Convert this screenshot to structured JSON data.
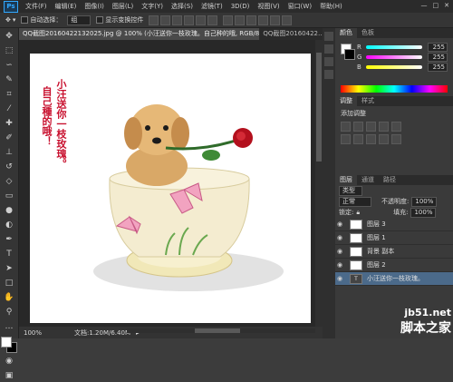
{
  "app": {
    "logo": "Ps"
  },
  "menu": [
    "文件(F)",
    "编辑(E)",
    "图像(I)",
    "图层(L)",
    "文字(Y)",
    "选择(S)",
    "滤镜(T)",
    "3D(D)",
    "视图(V)",
    "窗口(W)",
    "帮助(H)"
  ],
  "window_controls": [
    "—",
    "□",
    "✕"
  ],
  "options": {
    "auto_select_label": "自动选择：",
    "auto_select_value": "组",
    "show_transform_label": "显示变换控件"
  },
  "tabs": {
    "active": "QQ截图20160422132025.jpg @ 100% (小汪送你一枝玫瑰。自己种的哦, RGB/8#) *",
    "inactive": "QQ截图20160422…"
  },
  "canvas_text": {
    "line1": "小汪送你一枝玫瑰。",
    "line2": "自己種的哦！"
  },
  "status": {
    "zoom": "100%",
    "doc": "文档:1.20M/6.40M"
  },
  "color_panel": {
    "tabs": [
      "颜色",
      "色板"
    ],
    "channels": [
      {
        "label": "R",
        "value": "255"
      },
      {
        "label": "G",
        "value": "255"
      },
      {
        "label": "B",
        "value": "255"
      }
    ]
  },
  "adjust_panel": {
    "tabs": [
      "调整",
      "样式"
    ],
    "title": "添加调整"
  },
  "layers_panel": {
    "tabs": [
      "图层",
      "通道",
      "路径"
    ],
    "filter_label": "类型",
    "blend_mode": "正常",
    "opacity_label": "不透明度:",
    "opacity_value": "100%",
    "lock_label": "锁定:",
    "fill_label": "填充:",
    "fill_value": "100%",
    "layers": [
      {
        "name": "图层 3",
        "selected": false,
        "kind": "image"
      },
      {
        "name": "图层 1",
        "selected": false,
        "kind": "image"
      },
      {
        "name": "背景 副本",
        "selected": false,
        "kind": "image"
      },
      {
        "name": "图层 2",
        "selected": false,
        "kind": "image"
      },
      {
        "name": "小汪送你一枝玫瑰。",
        "selected": true,
        "kind": "text"
      }
    ]
  },
  "watermark": {
    "url": "jb51.net",
    "home": "脚本之家"
  },
  "colors": {
    "accent": "#31a8ff",
    "selected_layer": "#4b6a8a",
    "text_red": "#c8102e"
  },
  "icons": [
    "move-tool-icon",
    "marquee-tool-icon",
    "lasso-tool-icon",
    "quick-select-tool-icon",
    "crop-tool-icon",
    "eyedropper-tool-icon",
    "healing-tool-icon",
    "brush-tool-icon",
    "stamp-tool-icon",
    "history-brush-icon",
    "eraser-tool-icon",
    "gradient-tool-icon",
    "blur-tool-icon",
    "dodge-tool-icon",
    "pen-tool-icon",
    "type-tool-icon",
    "path-select-icon",
    "shape-tool-icon",
    "hand-tool-icon",
    "zoom-tool-icon"
  ]
}
